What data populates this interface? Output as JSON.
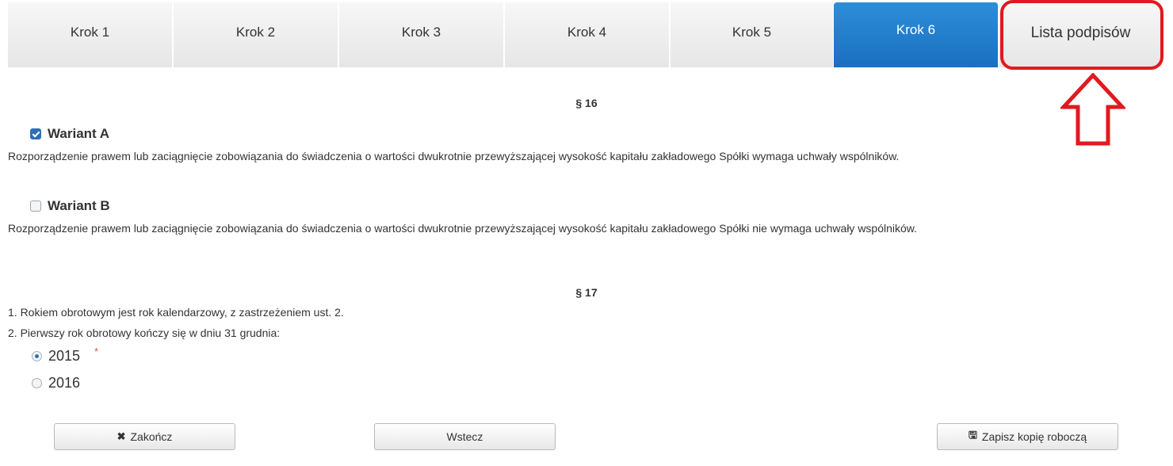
{
  "tabs": [
    {
      "label": "Krok 1",
      "active": false
    },
    {
      "label": "Krok 2",
      "active": false
    },
    {
      "label": "Krok 3",
      "active": false
    },
    {
      "label": "Krok 4",
      "active": false
    },
    {
      "label": "Krok 5",
      "active": false
    },
    {
      "label": "Krok 6",
      "active": true
    },
    {
      "label": "Lista podpisów",
      "active": false
    }
  ],
  "annotation": {
    "highlight_color": "#e2191f",
    "icon": "up-arrow-icon"
  },
  "section16": {
    "title": "§ 16",
    "variant_a": {
      "label": "Wariant A",
      "checked": true,
      "text": "Rozporządzenie prawem lub zaciągnięcie zobowiązania do świadczenia o wartości dwukrotnie przewyższającej wysokość kapitału zakładowego Spółki wymaga uchwały wspólników."
    },
    "variant_b": {
      "label": "Wariant B",
      "checked": false,
      "text": "Rozporządzenie prawem lub zaciągnięcie zobowiązania do świadczenia o wartości dwukrotnie przewyższającej wysokość kapitału zakładowego Spółki nie wymaga uchwały wspólników."
    }
  },
  "section17": {
    "title": "§ 17",
    "line1": "1. Rokiem obrotowym jest rok kalendarzowy, z zastrzeżeniem ust. 2.",
    "line2": "2. Pierwszy rok obrotowy kończy się w dniu 31 grudnia:",
    "options": [
      {
        "label": "2015",
        "selected": true
      },
      {
        "label": "2016",
        "selected": false
      }
    ],
    "required_mark": "*"
  },
  "buttons": {
    "finish": {
      "label": "Zakończ",
      "icon": "close-icon",
      "glyph": "✖"
    },
    "back": {
      "label": "Wstecz"
    },
    "save_draft": {
      "label": "Zapisz kopię roboczą",
      "icon": "floppy-disk-icon",
      "glyph": "🖫"
    }
  },
  "colors": {
    "accent": "#1a6fc0",
    "annotation": "#e2191f"
  }
}
